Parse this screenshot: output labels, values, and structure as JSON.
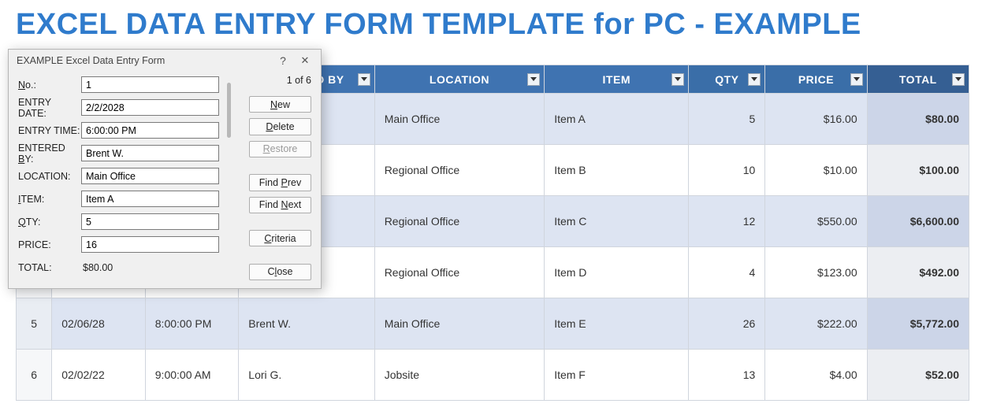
{
  "title": "EXCEL DATA ENTRY FORM TEMPLATE for PC - EXAMPLE",
  "columns": {
    "entered_by": "ENTERED BY",
    "location": "LOCATION",
    "item": "ITEM",
    "qty": "QTY",
    "price": "PRICE",
    "total": "TOTAL"
  },
  "rows": [
    {
      "idx": "",
      "date": "",
      "time": "",
      "by": "",
      "location": "Main Office",
      "item": "Item A",
      "qty": "5",
      "price": "$16.00",
      "total": "$80.00"
    },
    {
      "idx": "",
      "date": "",
      "time": "",
      "by": "",
      "location": "Regional Office",
      "item": "Item B",
      "qty": "10",
      "price": "$10.00",
      "total": "$100.00"
    },
    {
      "idx": "",
      "date": "",
      "time": "",
      "by": "",
      "location": "Regional Office",
      "item": "Item C",
      "qty": "12",
      "price": "$550.00",
      "total": "$6,600.00"
    },
    {
      "idx": "",
      "date": "",
      "time": "",
      "by": "",
      "location": "Regional Office",
      "item": "Item D",
      "qty": "4",
      "price": "$123.00",
      "total": "$492.00"
    },
    {
      "idx": "5",
      "date": "02/06/28",
      "time": "8:00:00 PM",
      "by": "Brent W.",
      "location": "Main Office",
      "item": "Item E",
      "qty": "26",
      "price": "$222.00",
      "total": "$5,772.00"
    },
    {
      "idx": "6",
      "date": "02/02/22",
      "time": "9:00:00 AM",
      "by": "Lori G.",
      "location": "Jobsite",
      "item": "Item F",
      "qty": "13",
      "price": "$4.00",
      "total": "$52.00"
    }
  ],
  "dialog": {
    "title": "EXAMPLE Excel Data Entry Form",
    "counter": "1 of 6",
    "fields": {
      "no_label_pre": "N",
      "no_label_post": "o.:",
      "date_label": "ENTRY DATE:",
      "time_label": "ENTRY TIME:",
      "by_label_pre": "ENTERED ",
      "by_label_u": "B",
      "by_label_post": "Y:",
      "loc_label": "LOCATION:",
      "item_label_u": "I",
      "item_label_post": "TEM:",
      "qty_label_u": "Q",
      "qty_label_post": "TY:",
      "price_label": "PRICE:",
      "total_label": "TOTAL:",
      "no": "1",
      "date": "2/2/2028",
      "time": "6:00:00 PM",
      "by": "Brent W.",
      "loc": "Main Office",
      "item": "Item A",
      "qty": "5",
      "price": "16",
      "total": "$80.00"
    },
    "buttons": {
      "new_u": "N",
      "new_post": "ew",
      "delete_u": "D",
      "delete_post": "elete",
      "restore_u": "R",
      "restore_post": "estore",
      "findprev_pre": "Find ",
      "findprev_u": "P",
      "findprev_post": "rev",
      "findnext_pre": "Find ",
      "findnext_u": "N",
      "findnext_post": "ext",
      "criteria_u": "C",
      "criteria_post": "riteria",
      "close_pre": "C",
      "close_u": "l",
      "close_post": "ose"
    }
  }
}
